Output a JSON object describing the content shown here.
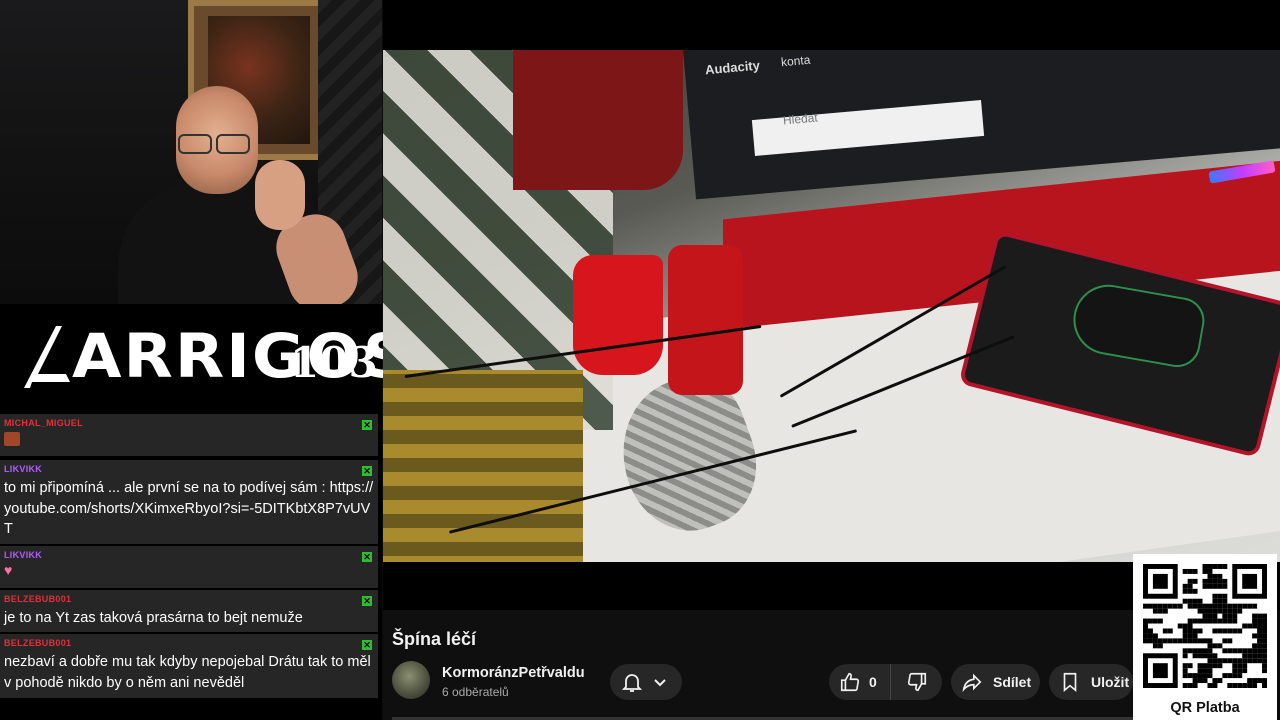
{
  "overlay": {
    "brand": "ARRIGOS",
    "episode": "103",
    "qr_label": "QR Platba"
  },
  "chat": {
    "messages": [
      {
        "user": "MICHAL_MIGUEL",
        "user_color": "#e0303a",
        "text": "",
        "emote": "pepe-emote"
      },
      {
        "user": "LIKVIKK",
        "user_color": "#b25cff",
        "text": "to mi připomíná ... ale první se na to podívej sám : https://youtube.com/shorts/XKimxeRbyoI?si=-5DITKbtX8P7vUVT"
      },
      {
        "user": "LIKVIKK",
        "user_color": "#b25cff",
        "text": "",
        "emote": "heart-emote"
      },
      {
        "user": "BELZEBUB001",
        "user_color": "#e0303a",
        "text": "je to na Yt zas taková prasárna to bejt nemuže"
      },
      {
        "user": "BELZEBUB001",
        "user_color": "#e0303a",
        "text": "nezbaví a dobře mu tak kdyby nepojebal Drátu tak to měl v pohodě nikdo by o něm ani nevěděl"
      }
    ]
  },
  "video": {
    "screen_app": "Audacity",
    "screen_app2": "konta",
    "search_placeholder": "Hledat"
  },
  "youtube": {
    "title": "Špína léčí",
    "channel": "KormoránzPetřvaldu",
    "subscribers": "6 odběratelů",
    "likes": "0",
    "share_label": "Sdílet",
    "save_label": "Uložit"
  },
  "colors": {
    "background": "#0f0f0f",
    "pill": "#272727",
    "chat_bg": "#262626",
    "verified_check": "#2dbf2d"
  }
}
